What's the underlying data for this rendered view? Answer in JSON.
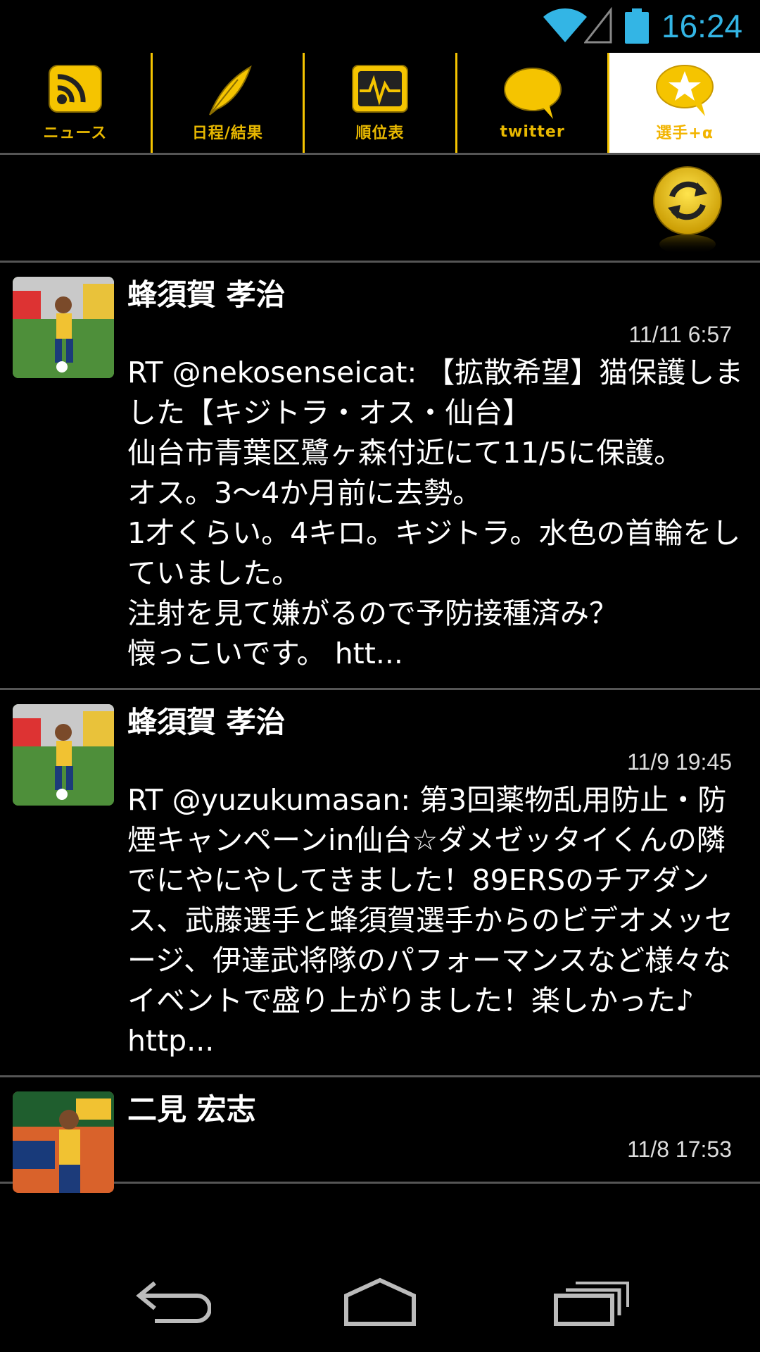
{
  "status_bar": {
    "time": "16:24",
    "icons": [
      "wifi-icon",
      "signal-icon",
      "battery-icon"
    ]
  },
  "tabs": [
    {
      "label": "ニュース",
      "icon": "rss-icon",
      "active": false
    },
    {
      "label": "日程/結果",
      "icon": "feather-icon",
      "active": false
    },
    {
      "label": "順位表",
      "icon": "pulse-chart-icon",
      "active": false
    },
    {
      "label": "twitter",
      "icon": "speech-bubble-icon",
      "active": false
    },
    {
      "label": "選手+α",
      "icon": "star-bubble-icon",
      "active": true
    }
  ],
  "toolbar": {
    "refresh_icon": "refresh-icon"
  },
  "tweets": [
    {
      "author": "蜂須賀 孝治",
      "timestamp": "11/11 6:57",
      "body": "RT @nekosenseicat: 【拡散希望】猫保護しました【キジトラ・オス・仙台】\n仙台市青葉区鷺ヶ森付近にて11/5に保護。\nオス。3〜4か月前に去勢。\n1才くらい。4キロ。キジトラ。水色の首輪をしていました。\n注射を見て嫌がるので予防接種済み？\n懐っこいです。 htt..."
    },
    {
      "author": "蜂須賀 孝治",
      "timestamp": "11/9 19:45",
      "body": "RT @yuzukumasan: 第3回薬物乱用防止・防煙キャンペーンin仙台☆ダメゼッタイくんの隣でにやにやしてきました！89ERSのチアダンス、武藤選手と蜂須賀選手からのビデオメッセージ、伊達武将隊のパフォーマンスなど様々なイベントで盛り上がりました！楽しかった♪\nhttp..."
    },
    {
      "author": "二見 宏志",
      "timestamp": "11/8 17:53",
      "body": ""
    }
  ],
  "nav_bar": {
    "back": "back-icon",
    "home": "home-icon",
    "recent": "recent-apps-icon"
  },
  "colors": {
    "accent_yellow": "#f5c400",
    "time_blue": "#33b5e5",
    "divider": "#555555"
  }
}
